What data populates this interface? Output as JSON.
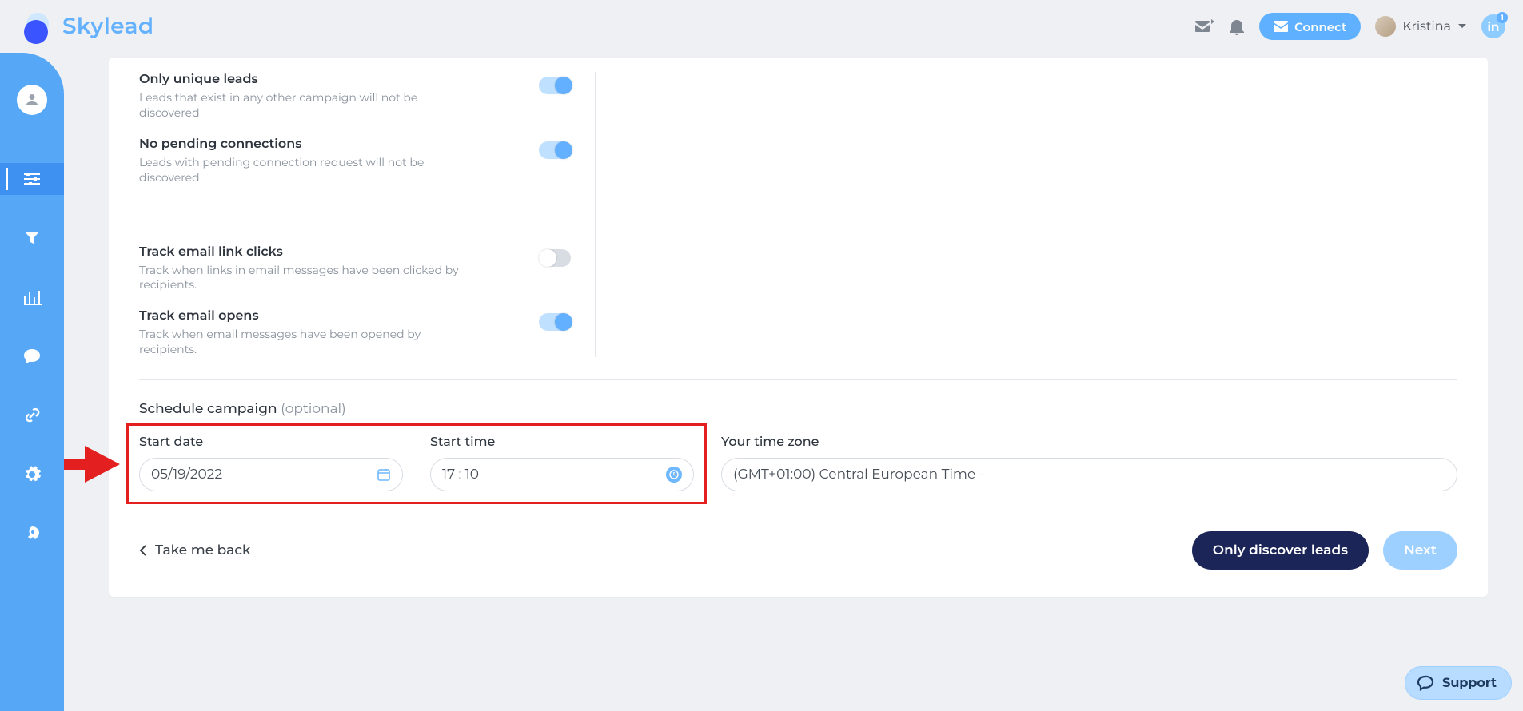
{
  "header": {
    "brand": "Skylead",
    "connect": "Connect",
    "user_name": "Kristina",
    "badge_count": "1"
  },
  "options": {
    "unique": {
      "title": "Only unique leads",
      "desc": "Leads that exist in any other campaign will not be discovered"
    },
    "pending": {
      "title": "No pending connections",
      "desc": "Leads with pending connection request will not be discovered"
    },
    "clicks": {
      "title": "Track email link clicks",
      "desc": "Track when links in email messages have been clicked by recipients."
    },
    "opens": {
      "title": "Track email opens",
      "desc": "Track when email messages have been opened by recipients."
    }
  },
  "schedule": {
    "title": "Schedule campaign",
    "optional": "(optional)",
    "start_date_label": "Start date",
    "start_date_value": "05/19/2022",
    "start_time_label": "Start time",
    "start_time_value": "17 : 10",
    "tz_label": "Your time zone",
    "tz_value": "(GMT+01:00) Central European Time -"
  },
  "footer": {
    "back": "Take me back",
    "discover": "Only discover leads",
    "next": "Next"
  },
  "support": {
    "label": "Support"
  }
}
